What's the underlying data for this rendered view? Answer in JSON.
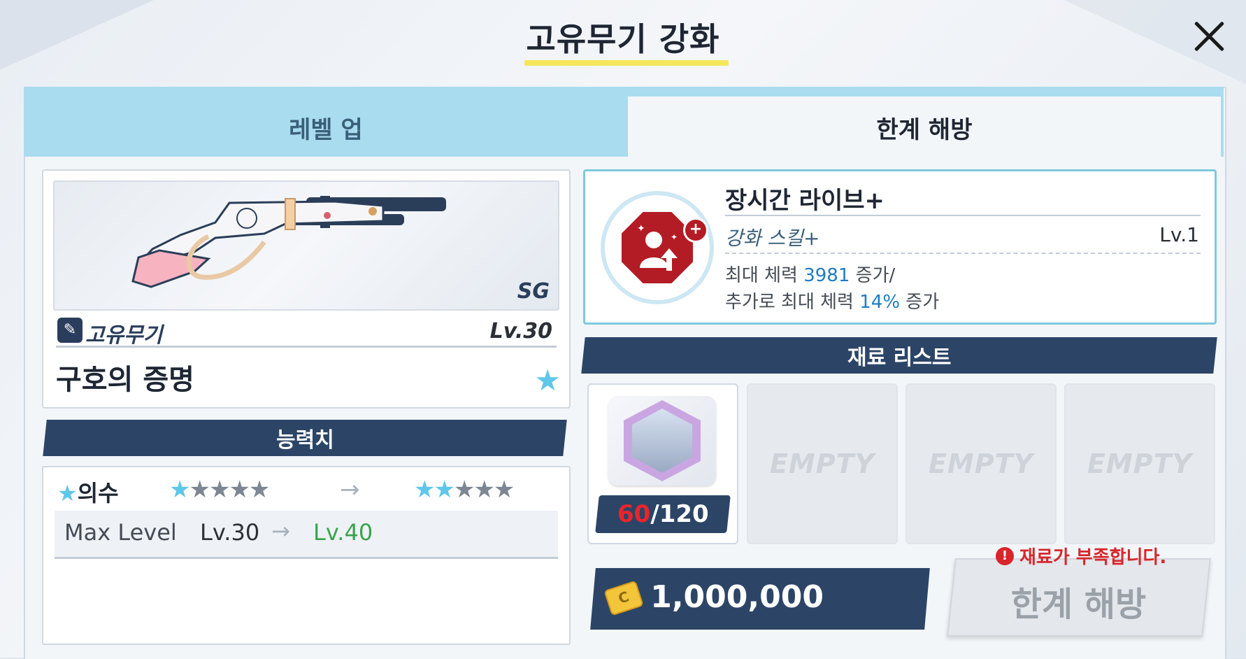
{
  "header": {
    "title": "고유무기 강화"
  },
  "tabs": [
    {
      "label": "레벨 업"
    },
    {
      "label": "한계 해방"
    }
  ],
  "weapon": {
    "type": "SG",
    "category": "고유무기",
    "level": "Lv.30",
    "name": "구호의 증명"
  },
  "stats": {
    "banner": "능력치",
    "rank_label": "의수",
    "rank_from_stars": "1/5",
    "rank_to_stars": "2/5",
    "max_level_label": "Max Level",
    "max_level_from": "Lv.30",
    "max_level_to": "Lv.40"
  },
  "skill": {
    "title": "장시간 라이브+",
    "subtitle": "강화 스킬+",
    "level": "Lv.1",
    "desc1_a": "최대 체력 ",
    "desc1_val": "3981",
    "desc1_b": " 증가/",
    "desc2_a": "추가로 최대 체력 ",
    "desc2_val": "14%",
    "desc2_b": " 증가"
  },
  "materials": {
    "banner": "재료 리스트",
    "owned": "60",
    "required": "/120",
    "empty_label": "EMPTY"
  },
  "cost": {
    "value": "1,000,000",
    "coin_icon": "credit-card-icon"
  },
  "warning": "재료가 부족합니다.",
  "action_button": "한계 해방"
}
